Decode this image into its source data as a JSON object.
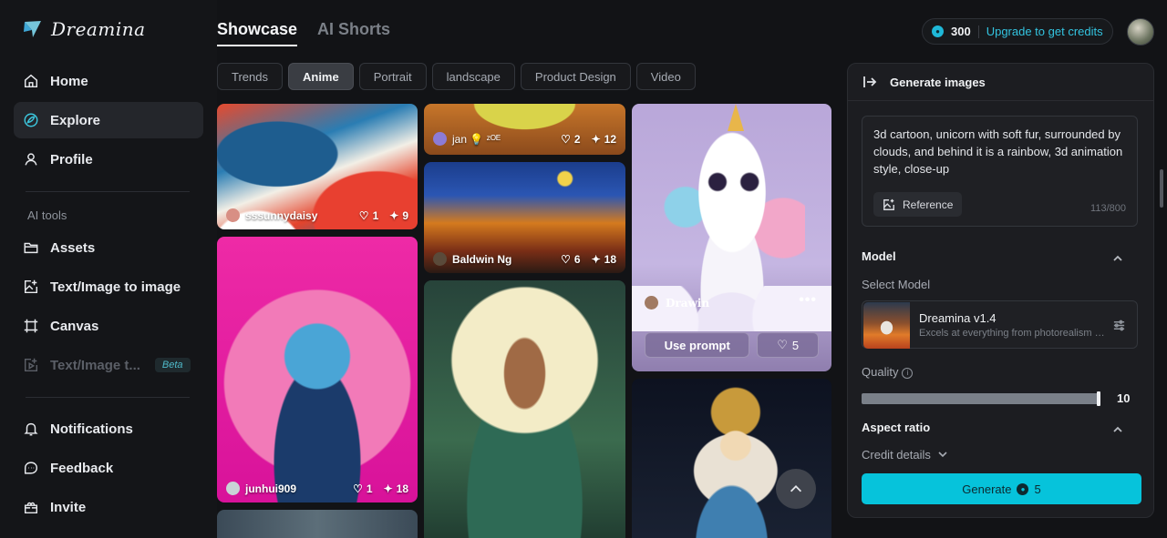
{
  "app": {
    "name": "Dreamina"
  },
  "sidebar": {
    "items": [
      {
        "label": "Home",
        "icon": "home-icon"
      },
      {
        "label": "Explore",
        "icon": "explore-icon",
        "active": true
      },
      {
        "label": "Profile",
        "icon": "user-icon"
      }
    ],
    "section_label": "AI tools",
    "tools": [
      {
        "label": "Assets",
        "icon": "folder-icon"
      },
      {
        "label": "Text/Image to image",
        "icon": "image-edit-icon"
      },
      {
        "label": "Canvas",
        "icon": "canvas-icon"
      },
      {
        "label": "Text/Image t...",
        "icon": "video-icon",
        "badge": "Beta",
        "disabled": true
      }
    ],
    "bottom": [
      {
        "label": "Notifications",
        "icon": "bell-icon"
      },
      {
        "label": "Feedback",
        "icon": "feedback-icon"
      },
      {
        "label": "Invite",
        "icon": "gift-icon"
      }
    ]
  },
  "header": {
    "tabs": [
      {
        "label": "Showcase",
        "active": true
      },
      {
        "label": "AI Shorts"
      }
    ],
    "credits": {
      "amount": "300",
      "upgrade_label": "Upgrade to get credits"
    }
  },
  "filters": [
    "Trends",
    "Anime",
    "Portrait",
    "landscape",
    "Product Design",
    "Video"
  ],
  "active_filter": "Anime",
  "gallery": {
    "cards": [
      {
        "author": "sssunnydaisy",
        "likes": "1",
        "remixes": "9"
      },
      {
        "author": "junhui909",
        "likes": "1",
        "remixes": "18"
      },
      {
        "author": "jan 💡 ᶻᴼᴱ",
        "likes": "2",
        "remixes": "12"
      },
      {
        "author": "Baldwin Ng",
        "likes": "6",
        "remixes": "18"
      },
      {
        "author": "Drawin",
        "likes": "5",
        "use_prompt_label": "Use prompt",
        "more": "•••"
      }
    ]
  },
  "panel": {
    "title": "Generate images",
    "prompt": "3d cartoon, unicorn with soft fur, surrounded by clouds, and behind it is a rainbow, 3d animation style, close-up",
    "reference_label": "Reference",
    "counter": "113/800",
    "model_section": "Model",
    "select_model_label": "Select Model",
    "model": {
      "name": "Dreamina v1.4",
      "description": "Excels at everything from photorealism to..."
    },
    "quality_label": "Quality",
    "quality_value": "10",
    "quality_fraction": 1.0,
    "aspect_ratio_label": "Aspect ratio",
    "credit_details_label": "Credit details",
    "generate_label": "Generate",
    "generate_cost": "5"
  },
  "colors": {
    "accent": "#06c3db",
    "link": "#33c4e0",
    "background": "#121316"
  }
}
